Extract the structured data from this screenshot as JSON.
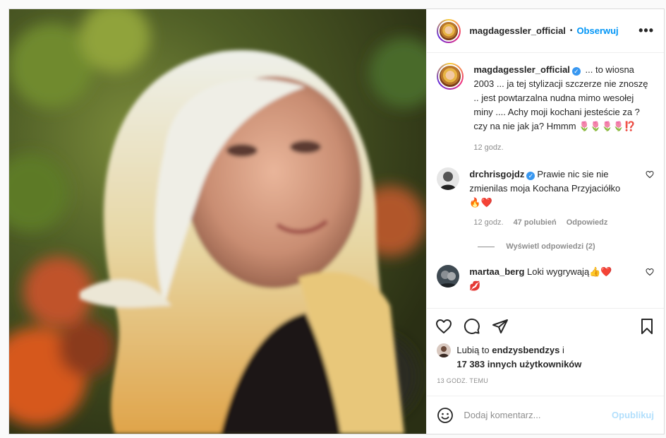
{
  "post": {
    "author": "magdagessler_official",
    "dot": "•",
    "follow_label": "Obserwuj",
    "more_label": "•••",
    "caption": {
      "author": "magdagessler_official",
      "verified_mark": "✓",
      "text": " ... to wiosna 2003 ... ja tej stylizacji szczerze nie znoszę .. jest powtarzalna nudna mimo wesołej miny .... Achy moji kochani jesteście za ? czy na nie jak ja? Hmmm ",
      "emoji": "🌷🌷🌷🌷⁉️",
      "time": "12 godz."
    },
    "comments": [
      {
        "author": "drchrisgojdz",
        "verified_mark": "✓",
        "text": "Prawie nic sie nie zmienilas moja Kochana Przyjaciółko",
        "emoji": "🔥❤️",
        "time": "12 godz.",
        "likes": "47 polubień",
        "reply_label": "Odpowiedz",
        "view_replies": "Wyświetl odpowiedzi (2)"
      },
      {
        "author": "martaa_berg",
        "text": "Loki wygrywają",
        "emoji": "👍❤️",
        "emoji2": "💋"
      }
    ],
    "likes_line": {
      "prefix": "Lubią to",
      "user": "endzysbendzys",
      "and": "i",
      "count_text": "17 383 innych użytkowników"
    },
    "timestamp": "13 GODZ. TEMU",
    "add_comment": {
      "placeholder": "Dodaj komentarz...",
      "publish_label": "Opublikuj"
    }
  },
  "colors": {
    "accent": "#0095f6",
    "publish_disabled": "#b2dffc",
    "muted": "#8e8e8e"
  }
}
